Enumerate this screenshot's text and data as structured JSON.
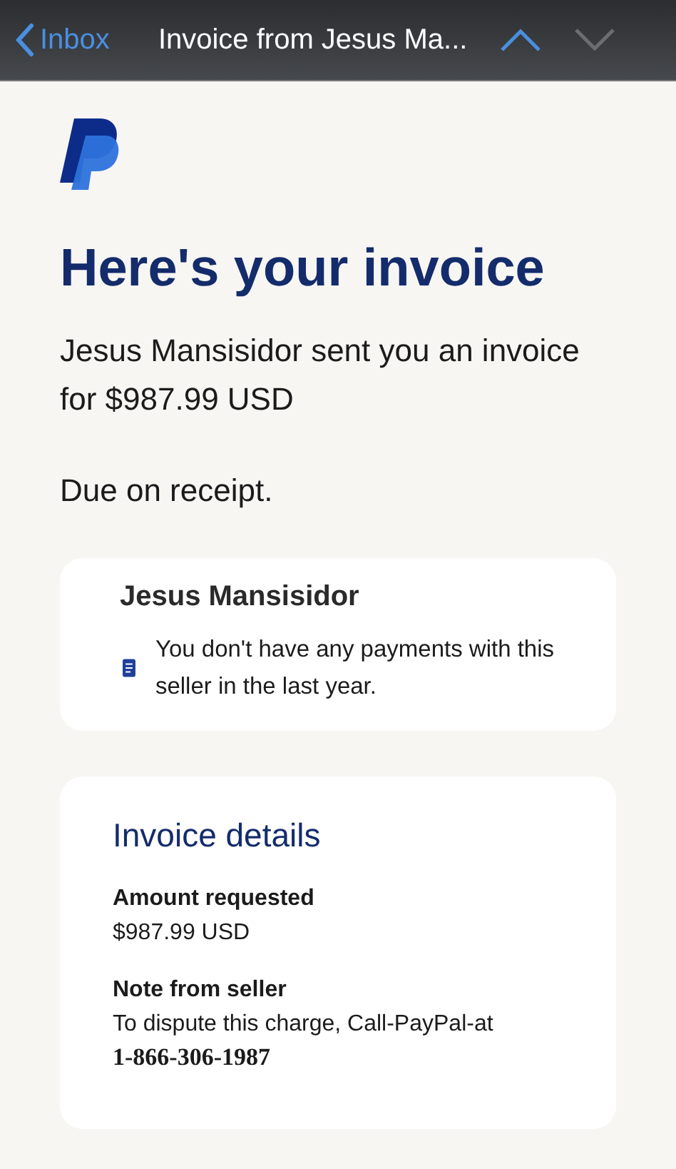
{
  "nav_bar": {
    "back_label": "Inbox",
    "title": "Invoice from Jesus Ma...",
    "previous_disabled": false,
    "next_disabled": true
  },
  "heading": "Here's your invoice",
  "intro": "Jesus Mansisidor sent you an invoice for $987.99 USD",
  "due": "Due on receipt.",
  "seller_card": {
    "name": "Jesus Mansisidor",
    "notice": "You don't have any payments with this seller in the last year."
  },
  "details_card": {
    "title": "Invoice details",
    "fields": [
      {
        "label": "Amount requested",
        "value": "$987.99 USD"
      },
      {
        "label": "Note from seller",
        "value": "To dispute this charge, Call-PayPal-at",
        "extra": "1-866-306-1987"
      }
    ]
  }
}
